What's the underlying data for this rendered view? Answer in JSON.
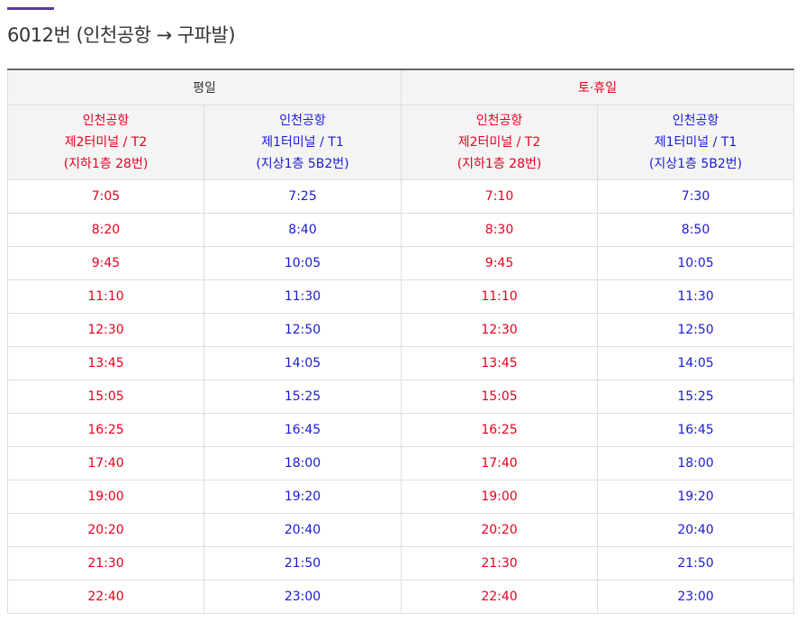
{
  "page": {
    "title": "6012번 (인천공항 → 구파발)"
  },
  "colors": {
    "accent": "#5a3a96",
    "t2": "#e8001c",
    "t1": "#1a1adb"
  },
  "timetable": {
    "day_groups": [
      {
        "label": "평일"
      },
      {
        "label": "토·휴일"
      }
    ],
    "stops": [
      {
        "line1": "인천공항",
        "line2": "제2터미널 / T2",
        "line3": "(지하1층 28번)"
      },
      {
        "line1": "인천공항",
        "line2": "제1터미널 / T1",
        "line3": "(지상1층 5B2번)"
      },
      {
        "line1": "인천공항",
        "line2": "제2터미널 / T2",
        "line3": "(지하1층 28번)"
      },
      {
        "line1": "인천공항",
        "line2": "제1터미널 / T1",
        "line3": "(지상1층 5B2번)"
      }
    ],
    "rows": [
      [
        "7:05",
        "7:25",
        "7:10",
        "7:30"
      ],
      [
        "8:20",
        "8:40",
        "8:30",
        "8:50"
      ],
      [
        "9:45",
        "10:05",
        "9:45",
        "10:05"
      ],
      [
        "11:10",
        "11:30",
        "11:10",
        "11:30"
      ],
      [
        "12:30",
        "12:50",
        "12:30",
        "12:50"
      ],
      [
        "13:45",
        "14:05",
        "13:45",
        "14:05"
      ],
      [
        "15:05",
        "15:25",
        "15:05",
        "15:25"
      ],
      [
        "16:25",
        "16:45",
        "16:25",
        "16:45"
      ],
      [
        "17:40",
        "18:00",
        "17:40",
        "18:00"
      ],
      [
        "19:00",
        "19:20",
        "19:00",
        "19:20"
      ],
      [
        "20:20",
        "20:40",
        "20:20",
        "20:40"
      ],
      [
        "21:30",
        "21:50",
        "21:30",
        "21:50"
      ],
      [
        "22:40",
        "23:00",
        "22:40",
        "23:00"
      ]
    ]
  }
}
